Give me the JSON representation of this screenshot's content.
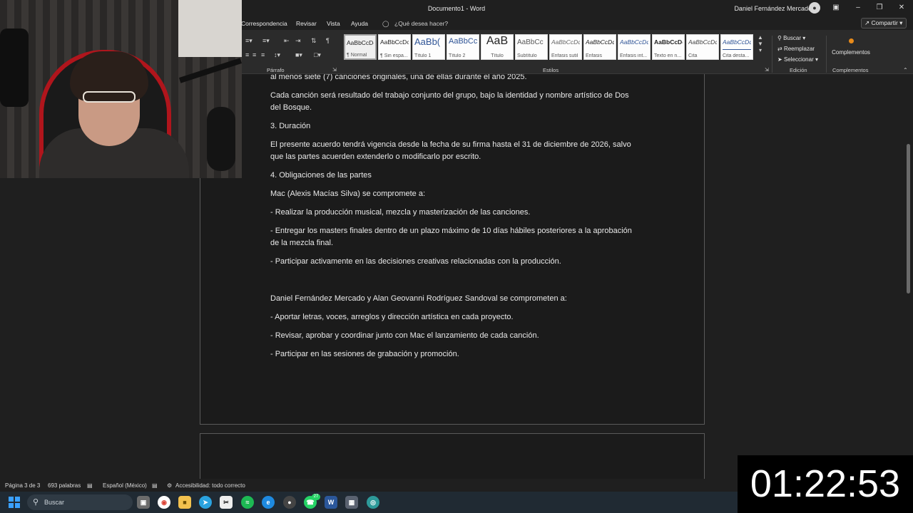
{
  "window": {
    "doc_title": "Documento1  -  Word",
    "user_name": "Daniel Fernández Mercado"
  },
  "menu": {
    "tabs": [
      "Correspondencia",
      "Revisar",
      "Vista",
      "Ayuda"
    ],
    "search_hint": "¿Qué desea hacer?",
    "share_label": "Compartir"
  },
  "ribbon": {
    "paragraph_label": "Párrafo",
    "styles_label": "Estilos",
    "styles": [
      {
        "sample": "AaBbCcDc",
        "name": "¶ Normal"
      },
      {
        "sample": "AaBbCcDc",
        "name": "¶ Sin espa..."
      },
      {
        "sample": "AaBb(",
        "name": "Título 1"
      },
      {
        "sample": "AaBbCc",
        "name": "Título 2"
      },
      {
        "sample": "AaB",
        "name": "Título"
      },
      {
        "sample": "AaBbCc",
        "name": "Subtítulo"
      },
      {
        "sample": "AaBbCcDc",
        "name": "Énfasis sutil"
      },
      {
        "sample": "AaBbCcDc",
        "name": "Énfasis"
      },
      {
        "sample": "AaBbCcDc",
        "name": "Énfasis int..."
      },
      {
        "sample": "AaBbCcDc",
        "name": "Texto en n..."
      },
      {
        "sample": "AaBbCcDc",
        "name": "Cita"
      },
      {
        "sample": "AaBbCcDc",
        "name": "Cita desta..."
      }
    ],
    "editing": {
      "find": "Buscar",
      "replace": "Reemplazar",
      "select": "Seleccionar",
      "group_label": "Edición"
    },
    "addins": {
      "button": "Complementos",
      "group_label": "Complementos"
    }
  },
  "document": {
    "paragraphs": [
      "al menos siete (7) canciones originales, una de ellas durante el año 2025.",
      "Cada canción será resultado del trabajo conjunto del grupo, bajo la identidad y nombre artístico de Dos del Bosque.",
      "3. Duración",
      "El presente acuerdo tendrá vigencia desde la fecha de su firma hasta el 31 de diciembre de 2026, salvo que las partes acuerden extenderlo o modificarlo por escrito.",
      "4. Obligaciones de las partes",
      "Mac (Alexis Macías Silva) se compromete a:",
      "- Realizar la producción musical, mezcla y masterización de las canciones.",
      "- Entregar los masters finales dentro de un plazo máximo de 10 días hábiles posteriores a la aprobación de la mezcla final.",
      "- Participar activamente en las decisiones creativas relacionadas con la producción.",
      "Daniel Fernández Mercado y Alan Geovanni Rodríguez Sandoval se comprometen a:",
      "- Aportar letras, voces, arreglos y dirección artística en cada proyecto.",
      "- Revisar, aprobar y coordinar junto con Mac el lanzamiento de cada canción.",
      "- Participar en las sesiones de grabación y promoción."
    ]
  },
  "status": {
    "page": "Página 3 de 3",
    "words": "693 palabras",
    "language": "Español (México)",
    "accessibility": "Accesibilidad: todo correcto"
  },
  "taskbar": {
    "search_label": "Buscar",
    "whatsapp_badge": "27"
  },
  "timer": "01:22:53"
}
